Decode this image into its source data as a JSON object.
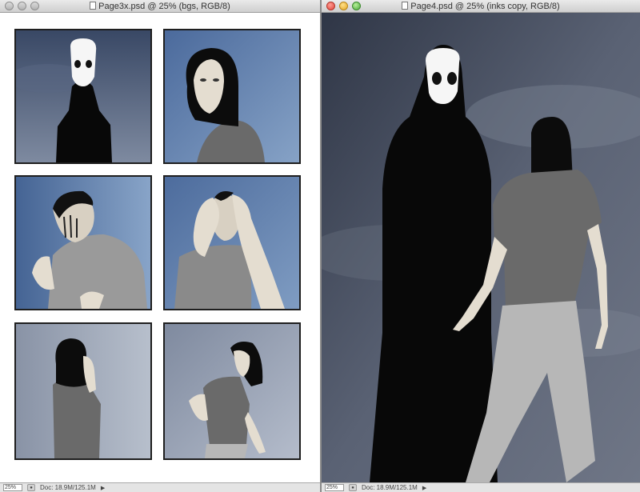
{
  "left_window": {
    "title": "Page3x.psd @ 25% (bgs, RGB/8)",
    "zoom": "25%",
    "doc_info": "Doc: 18.9M/125.1M"
  },
  "right_window": {
    "title": "Page4.psd @ 25% (inks copy, RGB/8)",
    "zoom": "25%",
    "doc_info": "Doc: 18.9M/125.1M"
  },
  "colors": {
    "sky_dark": "#2d3a55",
    "sky_blue": "#5f7fae",
    "sky_grey": "#8a93a3",
    "right_sky": "#4a5263",
    "figure_black": "#080808",
    "mask_white": "#f6f6f6",
    "shirt_grey": "#6a6a6a",
    "pants_grey": "#b7b7b7",
    "skin": "#e4ddd0"
  }
}
